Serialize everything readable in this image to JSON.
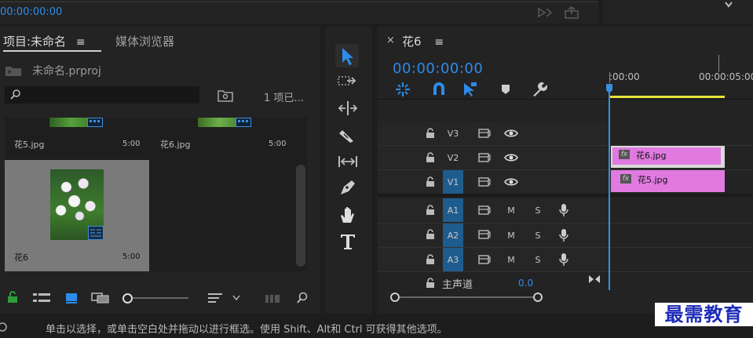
{
  "top": {
    "timecode": "00:00:00:00"
  },
  "project": {
    "tab_active": "项目:未命名",
    "tab_media": "媒体浏览器",
    "file": "未命名.prproj",
    "count": "1 项已...",
    "items": [
      {
        "name": "花5.jpg",
        "duration": "5:00"
      },
      {
        "name": "花6.jpg",
        "duration": "5:00"
      },
      {
        "name": "花6",
        "duration": "5:00"
      }
    ]
  },
  "timeline": {
    "tab": "花6",
    "timecode": "00:00:00:00",
    "ruler": {
      "start": ":00:00",
      "mark": "00:00:05:00"
    },
    "video_tracks": [
      "V3",
      "V2",
      "V1"
    ],
    "audio_tracks": [
      "A1",
      "A2",
      "A3"
    ],
    "mute_label": "M",
    "solo_label": "S",
    "master": {
      "label": "主声道",
      "value": "0.0"
    },
    "clips": {
      "v2": "花6.jpg",
      "v1": "花5.jpg"
    },
    "fx_label": "fx"
  },
  "status": {
    "text": "单击以选择，或单击空白处并拖动以进行框选。使用 Shift、Alt和 Ctrl 可获得其他选项。"
  },
  "watermark": "最需教育"
}
